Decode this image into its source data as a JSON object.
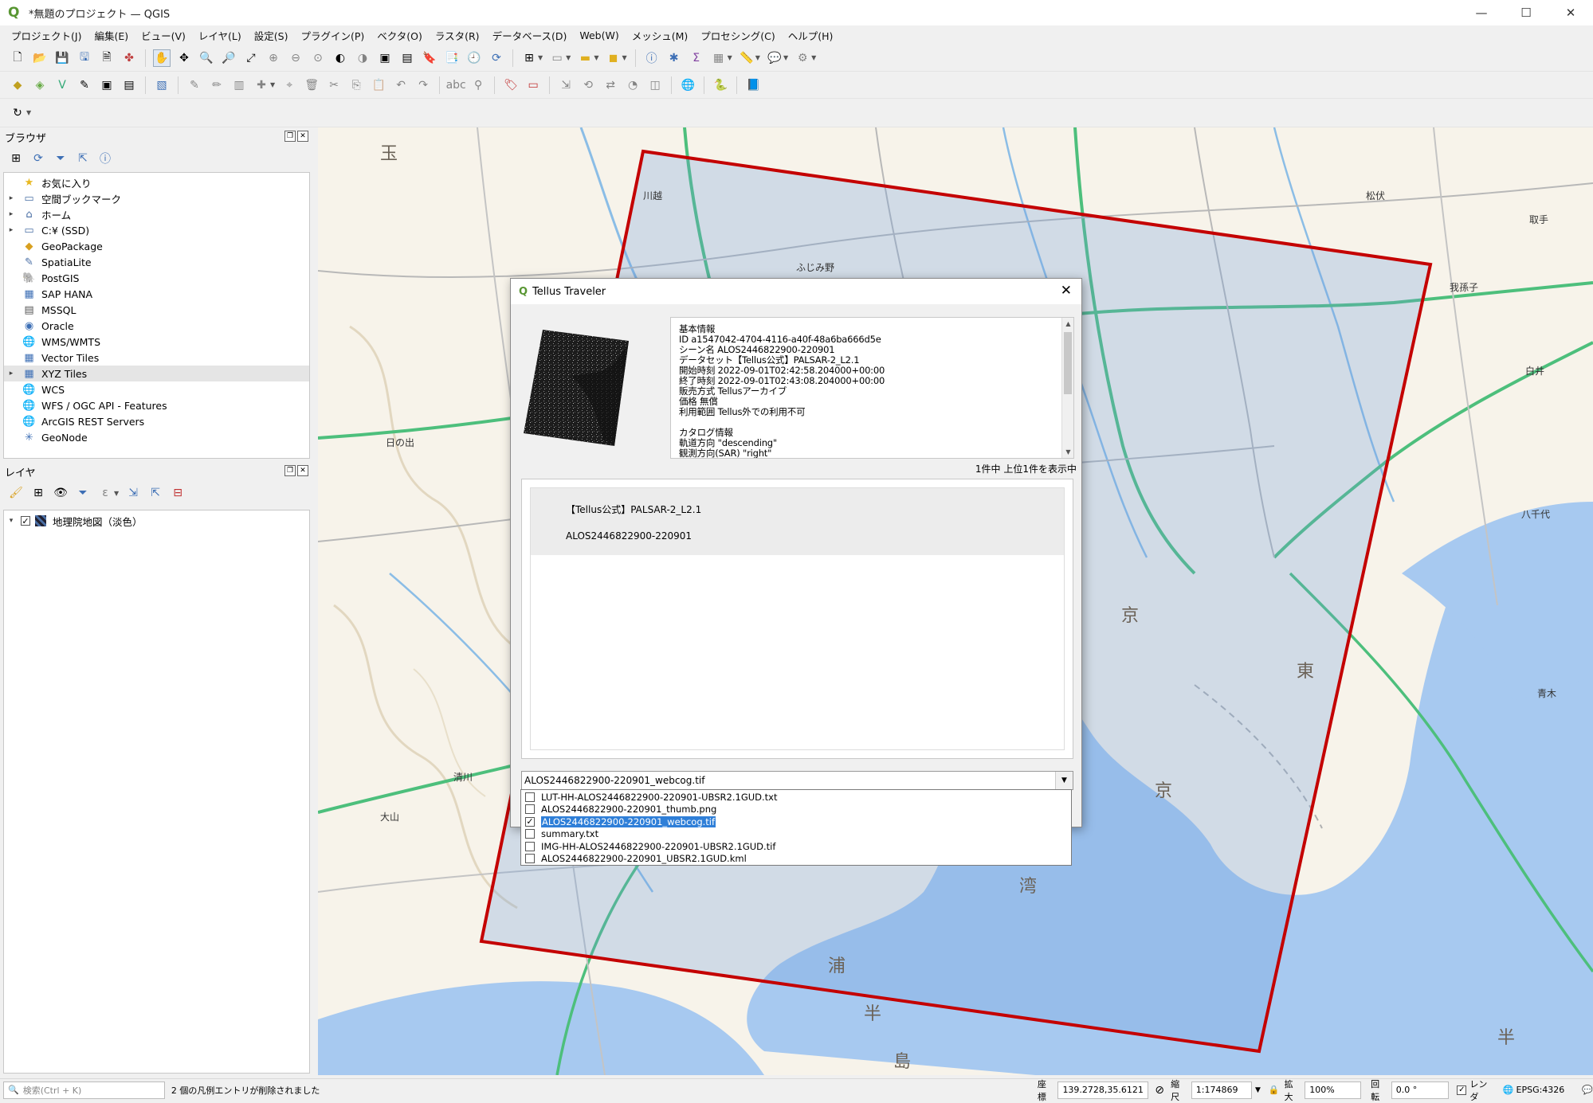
{
  "window": {
    "title": "*無題のプロジェクト — QGIS",
    "minimize": "—",
    "maximize": "☐",
    "close": "✕"
  },
  "menu": [
    "プロジェクト(J)",
    "編集(E)",
    "ビュー(V)",
    "レイヤ(L)",
    "設定(S)",
    "プラグイン(P)",
    "ベクタ(O)",
    "ラスタ(R)",
    "データベース(D)",
    "Web(W)",
    "メッシュ(M)",
    "プロセシング(C)",
    "ヘルプ(H)"
  ],
  "browser": {
    "title": "ブラウザ",
    "items": [
      {
        "label": "お気に入り",
        "icon": "star-icon",
        "arrow": ""
      },
      {
        "label": "空間ブックマーク",
        "icon": "bookmark-icon",
        "arrow": "▸"
      },
      {
        "label": "ホーム",
        "icon": "home-folder-icon",
        "arrow": "▸"
      },
      {
        "label": "C:¥ (SSD)",
        "icon": "drive-folder-icon",
        "arrow": "▸"
      },
      {
        "label": "GeoPackage",
        "icon": "geopackage-icon",
        "arrow": ""
      },
      {
        "label": "SpatiaLite",
        "icon": "spatialite-icon",
        "arrow": ""
      },
      {
        "label": "PostGIS",
        "icon": "postgis-icon",
        "arrow": ""
      },
      {
        "label": "SAP HANA",
        "icon": "sap-hana-icon",
        "arrow": ""
      },
      {
        "label": "MSSQL",
        "icon": "mssql-icon",
        "arrow": ""
      },
      {
        "label": "Oracle",
        "icon": "oracle-icon",
        "arrow": ""
      },
      {
        "label": "WMS/WMTS",
        "icon": "wms-icon",
        "arrow": ""
      },
      {
        "label": "Vector Tiles",
        "icon": "vector-tiles-icon",
        "arrow": ""
      },
      {
        "label": "XYZ Tiles",
        "icon": "xyz-tiles-icon",
        "arrow": "▸"
      },
      {
        "label": "WCS",
        "icon": "wcs-icon",
        "arrow": ""
      },
      {
        "label": "WFS / OGC API - Features",
        "icon": "wfs-icon",
        "arrow": ""
      },
      {
        "label": "ArcGIS REST Servers",
        "icon": "arcgis-icon",
        "arrow": ""
      },
      {
        "label": "GeoNode",
        "icon": "geonode-icon",
        "arrow": ""
      }
    ]
  },
  "layers": {
    "title": "レイヤ",
    "items": [
      {
        "label": "地理院地図（淡色）",
        "checked": true
      }
    ]
  },
  "dialog": {
    "title": "Tellus Traveler",
    "close": "✕",
    "info_text": "基本情報\nID a1547042-4704-4116-a40f-48a6ba666d5e\nシーン名 ALOS2446822900-220901\nデータセット【Tellus公式】PALSAR-2_L2.1\n開始時刻 2022-09-01T02:42:58.204000+00:00\n終了時刻 2022-09-01T02:43:08.204000+00:00\n販売方式 Tellusアーカイブ\n価格 無償\n利用範囲 Tellus外での利用不可\n\nカタログ情報\n軌道方向 \"descending\"\n観測方向(SAR) \"right\"",
    "count_text": "1件中 上位1件を表示中",
    "result_dataset": "【Tellus公式】PALSAR-2_L2.1",
    "result_scene": "ALOS2446822900-220901",
    "combo_value": "ALOS2446822900-220901_webcog.tif",
    "files": [
      {
        "name": "LUT-HH-ALOS2446822900-220901-UBSR2.1GUD.txt",
        "checked": false,
        "selected": false
      },
      {
        "name": "ALOS2446822900-220901_thumb.png",
        "checked": false,
        "selected": false
      },
      {
        "name": "ALOS2446822900-220901_webcog.tif",
        "checked": true,
        "selected": true
      },
      {
        "name": "summary.txt",
        "checked": false,
        "selected": false
      },
      {
        "name": "IMG-HH-ALOS2446822900-220901-UBSR2.1GUD.tif",
        "checked": false,
        "selected": false
      },
      {
        "name": "ALOS2446822900-220901_UBSR2.1GUD.kml",
        "checked": false,
        "selected": false
      }
    ]
  },
  "status": {
    "search_placeholder": "検索(Ctrl + K)",
    "message": "2 個の凡例エントリが削除されました",
    "coord_label": "座標",
    "coord_value": "139.2728,35.6121",
    "scale_label": "縮尺",
    "scale_value": "1:174869",
    "magnifier_label": "拡大",
    "magnifier_value": "100%",
    "rotation_label": "回転",
    "rotation_value": "0.0 °",
    "render_label": "レンダ",
    "crs": "EPSG:4326"
  },
  "map_labels": [
    "玉",
    "京",
    "東",
    "京",
    "湾",
    "浦",
    "半",
    "島",
    "半",
    "日の出",
    "大山",
    "清川",
    "川越",
    "ふじみ野",
    "松伏",
    "取手",
    "我孫子",
    "白井",
    "八千代",
    "青木"
  ],
  "colors": {
    "footprint": "#c40000",
    "sea": "#a7c9f0",
    "land": "#f7f3ea",
    "road_green": "#4dbf7c",
    "accent": "#2f7fd8"
  }
}
